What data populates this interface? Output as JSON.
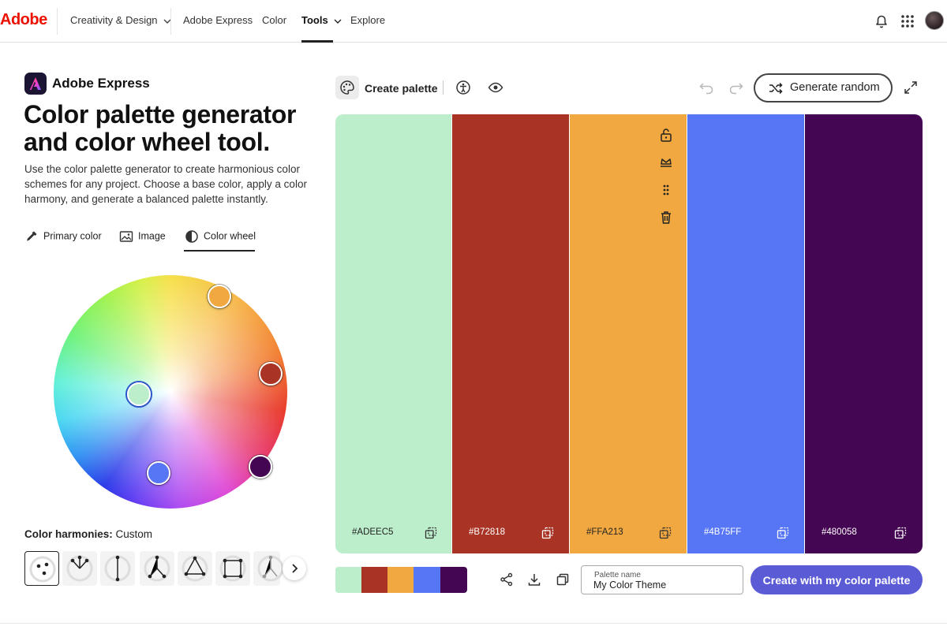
{
  "nav": {
    "brand": "Adobe",
    "items": [
      "Creativity & Design",
      "Adobe Express",
      "Color",
      "Tools",
      "Explore"
    ],
    "active": "Tools",
    "icons": [
      "bell-icon",
      "apps-grid-icon",
      "avatar"
    ]
  },
  "left": {
    "app_name": "Adobe Express",
    "headline": "Color palette generator and color wheel tool.",
    "description": "Use the color palette generator to create harmonious color schemes for any project. Choose a base color, apply a color harmony, and generate a balanced palette instantly.",
    "modes": [
      "Primary color",
      "Image",
      "Color wheel"
    ],
    "active_mode": "Color wheel",
    "harmonies_label": "Color harmonies:",
    "harmonies_value": "Custom",
    "harmony_icons": [
      "custom-harmony-icon",
      "analogous-harmony-icon",
      "complementary-harmony-icon",
      "split-complementary-harmony-icon",
      "triad-harmony-icon",
      "square-harmony-icon",
      "compound-harmony-icon"
    ],
    "wheel_handles": [
      "#ADEEC5",
      "#B72818",
      "#FFA213",
      "#4B75FF",
      "#480058"
    ]
  },
  "toolbar": {
    "create_palette": "Create palette",
    "generate_random": "Generate random"
  },
  "palette": [
    {
      "hex": "#ADEEC5",
      "color": "#BCEECB",
      "text_color": "#222222"
    },
    {
      "hex": "#B72818",
      "color": "#A93425",
      "text_color": "#ffffff"
    },
    {
      "hex": "#FFA213",
      "color": "#F2A840",
      "text_color": "#222222"
    },
    {
      "hex": "#4B75FF",
      "color": "#5676F5",
      "text_color": "#ffffff"
    },
    {
      "hex": "#480058",
      "color": "#440553",
      "text_color": "#ffffff"
    }
  ],
  "palette_name": {
    "label": "Palette name",
    "value": "My Color Theme"
  },
  "cta_label": "Create with my color palette"
}
